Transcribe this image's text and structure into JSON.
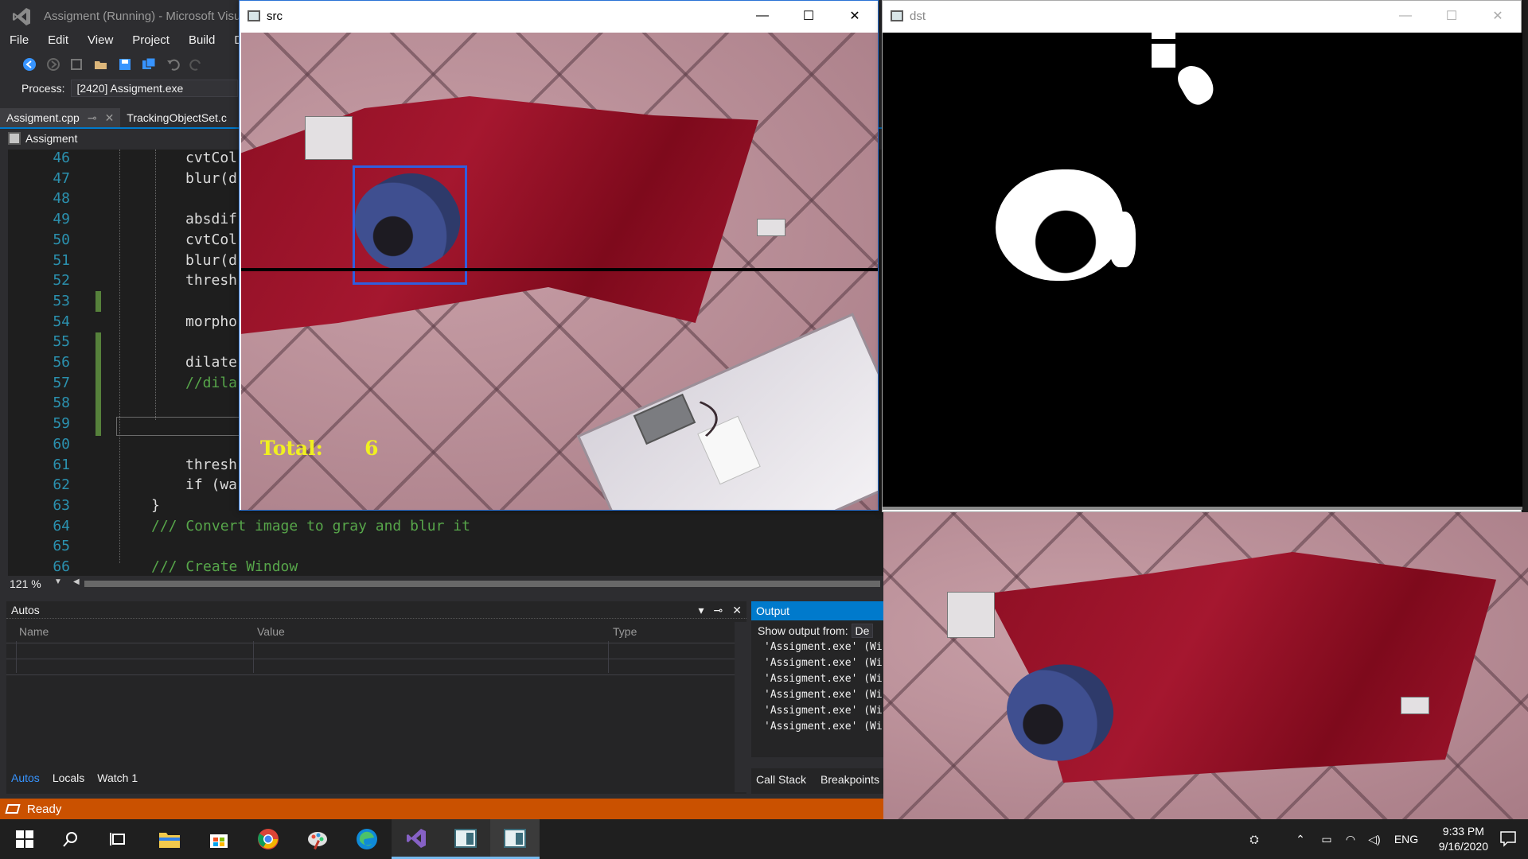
{
  "vs": {
    "title": "Assigment (Running) - Microsoft Visu",
    "menu": [
      "File",
      "Edit",
      "View",
      "Project",
      "Build",
      "D"
    ],
    "process_label": "Process:",
    "process_value": "[2420] Assigment.exe",
    "tabs": [
      {
        "label": "Assigment.cpp",
        "pin": "⊸",
        "close": "✕"
      },
      {
        "label": "TrackingObjectSet.c"
      }
    ],
    "breadcrumb": "Assigment",
    "code_lines": [
      {
        "num": "46",
        "text": "cvtCol",
        "indent": 1
      },
      {
        "num": "47",
        "text": "blur(d",
        "indent": 1
      },
      {
        "num": "48",
        "text": "",
        "indent": 1
      },
      {
        "num": "49",
        "text": "absdif",
        "indent": 1
      },
      {
        "num": "50",
        "text": "cvtCol",
        "indent": 1
      },
      {
        "num": "51",
        "text": "blur(d",
        "indent": 1
      },
      {
        "num": "52",
        "text": "thresh",
        "indent": 1
      },
      {
        "num": "53",
        "text": "",
        "indent": 1
      },
      {
        "num": "54",
        "text": "morpho",
        "indent": 1
      },
      {
        "num": "55",
        "text": "",
        "indent": 1
      },
      {
        "num": "56",
        "text": "dilate",
        "indent": 1
      },
      {
        "num": "57",
        "text": "//dila",
        "indent": 1,
        "comment": true
      },
      {
        "num": "58",
        "text": "",
        "indent": 1
      },
      {
        "num": "59",
        "text": "",
        "indent": 1
      },
      {
        "num": "60",
        "text": "",
        "indent": 1
      },
      {
        "num": "61",
        "text": "thresh",
        "indent": 1
      },
      {
        "num": "62",
        "text": "if (wa",
        "indent": 1
      },
      {
        "num": "63",
        "text": "}",
        "indent": 0
      },
      {
        "num": "64",
        "text": "/// Convert image to gray and blur it",
        "indent": 0,
        "comment": true
      },
      {
        "num": "65",
        "text": "",
        "indent": 0
      },
      {
        "num": "66",
        "text": "/// Create Window",
        "indent": 0,
        "comment": true
      }
    ],
    "zoom": "121 %",
    "autos": {
      "title": "Autos",
      "columns": [
        "Name",
        "Value",
        "Type"
      ]
    },
    "bottom_tabs_left": [
      "Autos",
      "Locals",
      "Watch 1"
    ],
    "output": {
      "title": "Output",
      "show_from_label": "Show output from:",
      "show_from_value": "De",
      "lines": [
        "'Assigment.exe' (Wi",
        "'Assigment.exe' (Wi",
        "'Assigment.exe' (Wi",
        "'Assigment.exe' (Wi",
        "'Assigment.exe' (Wi",
        "'Assigment.exe' (Wi"
      ]
    },
    "bottom_tabs_right": [
      "Call Stack",
      "Breakpoints"
    ],
    "status": "Ready"
  },
  "src_window": {
    "title": "src",
    "total_label": "Total:",
    "total_value": "6"
  },
  "dst_window": {
    "title": "dst"
  },
  "taskbar": {
    "lang": "ENG",
    "time": "9:33 PM",
    "date": "9/16/2020"
  },
  "colors": {
    "vs_background": "#1e1e1e",
    "status_bar": "#ca5100",
    "accent": "#007acc",
    "bbox": "#2f5ee0",
    "total_text": "#f0f020"
  }
}
